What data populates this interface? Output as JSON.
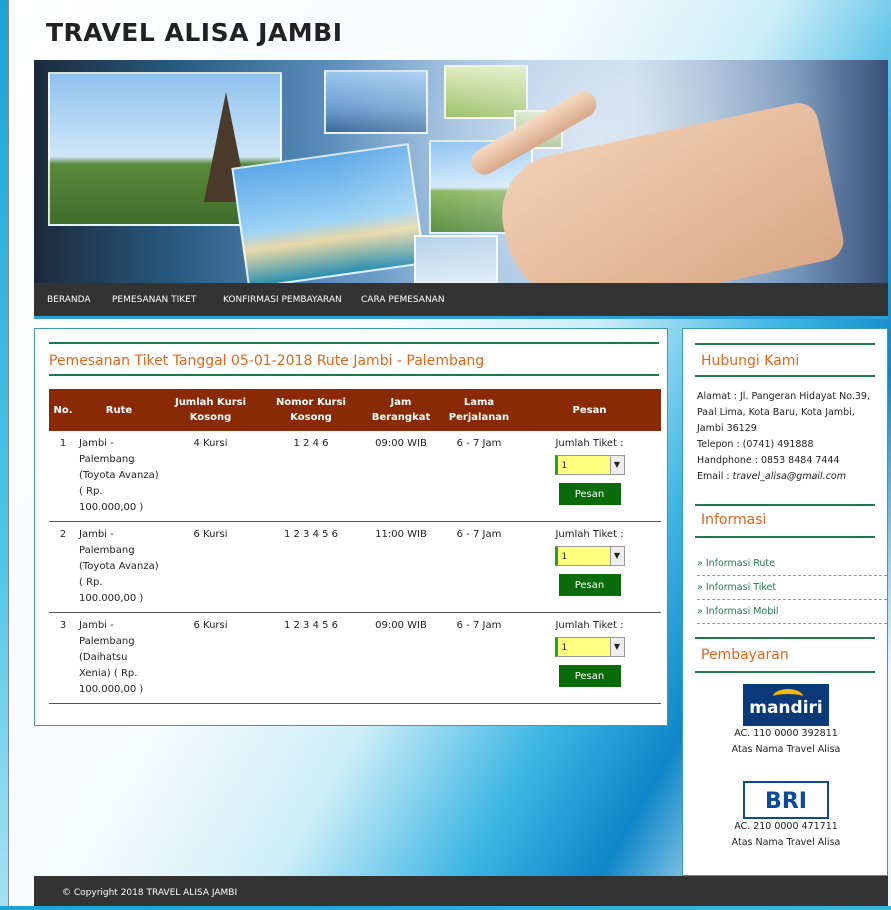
{
  "site": {
    "title": "TRAVEL ALISA JAMBI"
  },
  "nav": {
    "items": [
      "BERANDA",
      "PEMESANAN TIKET",
      "KONFIRMASI PEMBAYARAN",
      "CARA PEMESANAN"
    ]
  },
  "main": {
    "title": "Pemesanan Tiket Tanggal 05-01-2018 Rute Jambi - Palembang",
    "columns": [
      "No.",
      "Rute",
      "Jumlah Kursi Kosong",
      "Nomor Kursi Kosong",
      "Jam Berangkat",
      "Lama Perjalanan",
      "Pesan"
    ],
    "rows": [
      {
        "no": "1",
        "rute": "Jambi - Palembang (Toyota Avanza) ( Rp. 100.000,00 )",
        "kursi": "4 Kursi",
        "nomor": "1 2 4 6",
        "jam": "09:00 WIB",
        "lama": "6 - 7 Jam",
        "label": "Jumlah Tiket :",
        "qty": "1",
        "button": "Pesan"
      },
      {
        "no": "2",
        "rute": "Jambi - Palembang (Toyota Avanza) ( Rp. 100.000,00 )",
        "kursi": "6 Kursi",
        "nomor": "1 2 3 4 5 6",
        "jam": "11:00 WIB",
        "lama": "6 - 7 Jam",
        "label": "Jumlah Tiket :",
        "qty": "1",
        "button": "Pesan"
      },
      {
        "no": "3",
        "rute": "Jambi - Palembang (Daihatsu Xenia) ( Rp. 100.000,00 )",
        "kursi": "6 Kursi",
        "nomor": "1 2 3 4 5 6",
        "jam": "09:00 WIB",
        "lama": "6 - 7 Jam",
        "label": "Jumlah Tiket :",
        "qty": "1",
        "button": "Pesan"
      }
    ]
  },
  "sidebar": {
    "contact": {
      "heading": "Hubungi Kami",
      "address": "Alamat : Jl. Pangeran Hidayat No.39, Paal Lima, Kota Baru, Kota Jambi, Jambi 36129",
      "phone": "Telepon : (0741) 491888",
      "handphone": "Handphone : 0853 8484 7444",
      "email_label": "Email : ",
      "email": "travel_alisa@gmail.com"
    },
    "info": {
      "heading": "Informasi",
      "links": [
        "» Informasi Rute",
        "» Informasi Tiket",
        "» Informasi Mobil"
      ]
    },
    "payment": {
      "heading": "Pembayaran",
      "banks": [
        {
          "logo": "mandiri",
          "account": "AC. 110 0000 392811",
          "name": "Atas Nama Travel Alisa"
        },
        {
          "logo": "BRI",
          "account": "AC. 210 0000 471711",
          "name": "Atas Nama Travel Alisa"
        }
      ]
    }
  },
  "footer": {
    "text": "© Copyright 2018 TRAVEL ALISA JAMBI"
  },
  "colors": {
    "nav_bg": "#333333",
    "header_bg": "#8a2a05",
    "accent": "#e0661a",
    "button": "#0a6b0a",
    "rule": "#1e7b4c"
  },
  "icons": {
    "select_arrow": "chevron-down-icon"
  }
}
